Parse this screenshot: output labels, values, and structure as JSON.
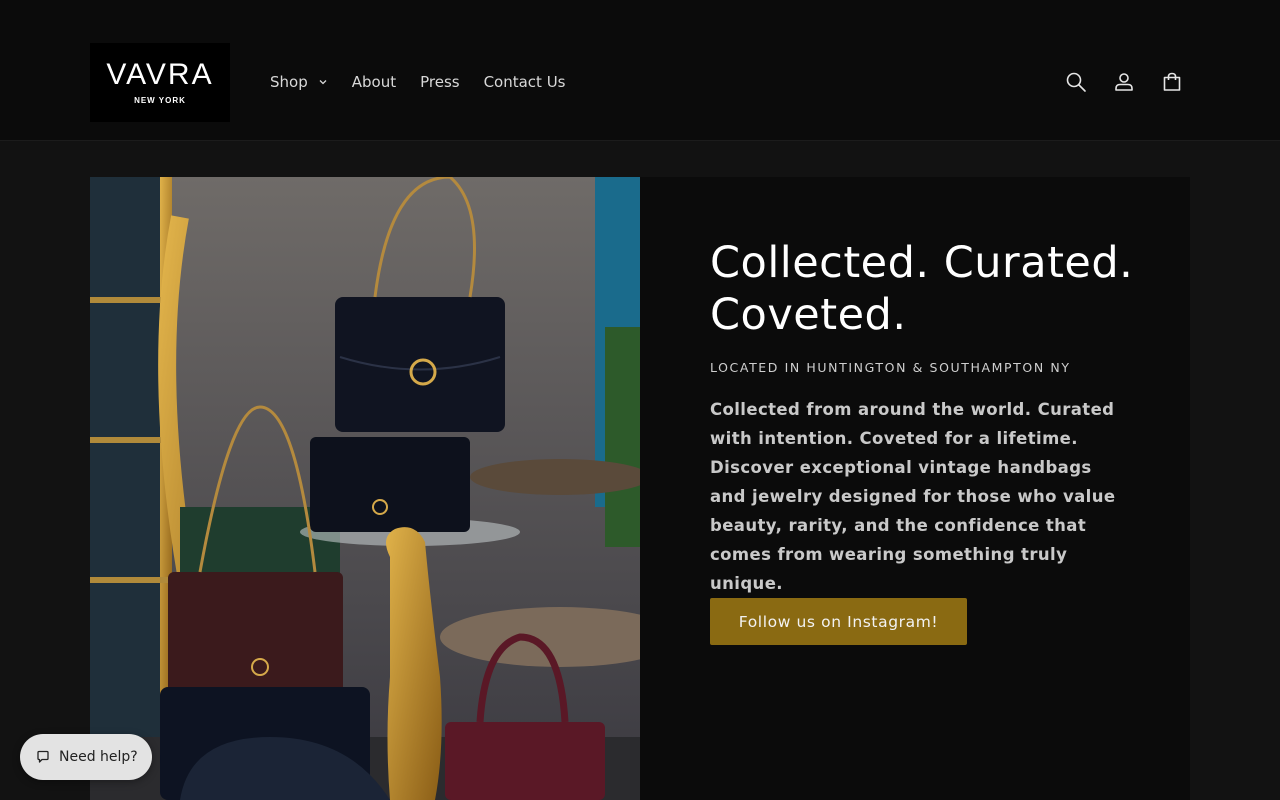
{
  "brand": {
    "logo_main": "VAVRA",
    "logo_sub": "NEW YORK"
  },
  "nav": {
    "items": [
      {
        "label": "Shop",
        "has_dropdown": true
      },
      {
        "label": "About"
      },
      {
        "label": "Press"
      },
      {
        "label": "Contact Us"
      }
    ]
  },
  "header_icons": [
    "search-icon",
    "account-icon",
    "cart-icon"
  ],
  "hero": {
    "title_line1": "Collected. Curated.",
    "title_line2": "Coveted.",
    "subheading": "LOCATED IN HUNTINGTON & SOUTHAMPTON NY",
    "description": "Collected from around the world. Curated with intention. Coveted for a lifetime. Discover exceptional vintage handbags and jewelry designed for those who value beauty, rarity, and the confidence that comes from wearing something truly unique.",
    "button_label": "Follow us on Instagram!",
    "button_color": "#8a6a12"
  },
  "help_widget": {
    "label": "Need help?"
  },
  "colors": {
    "header_bg": "#0b0b0b",
    "page_bg": "#121212",
    "panel_bg": "#0b0b0b"
  }
}
